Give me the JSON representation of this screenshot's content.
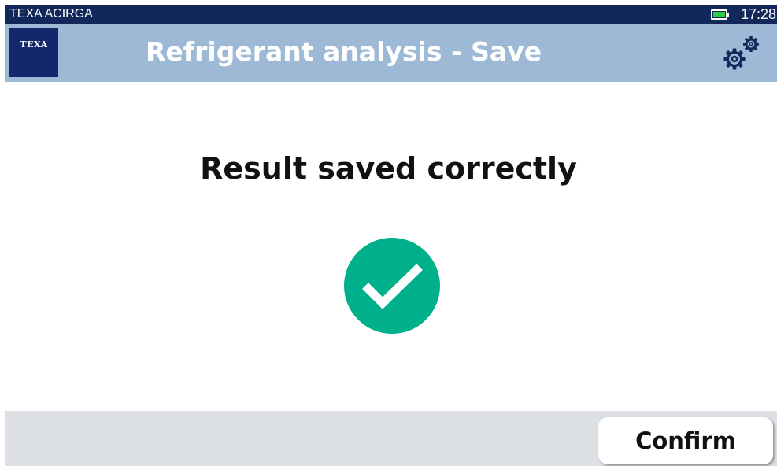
{
  "status_bar": {
    "app_name": "TEXA ACIRGA",
    "time": "17:28",
    "battery_icon": "battery-icon",
    "battery_color": "#2ecc40"
  },
  "header": {
    "logo_text": "TEXA",
    "title": "Refrigerant analysis - Save",
    "settings_icon": "gears-icon",
    "background_color": "#9db9d5"
  },
  "main": {
    "message": "Result saved correctly",
    "status_icon": "check-circle-icon",
    "status_color": "#00b08a"
  },
  "footer": {
    "confirm_label": "Confirm"
  }
}
